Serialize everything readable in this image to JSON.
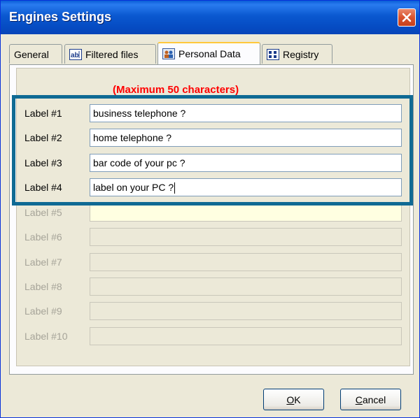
{
  "window": {
    "title": "Engines Settings",
    "close_icon": "close-icon"
  },
  "tabs": [
    {
      "label": "General",
      "icon": null,
      "active": false
    },
    {
      "label": "Filtered files",
      "icon": "ab-text-icon",
      "active": false
    },
    {
      "label": "Personal Data",
      "icon": "personal-data-icon",
      "active": true
    },
    {
      "label": "Registry",
      "icon": "registry-icon",
      "active": false
    }
  ],
  "personal_data": {
    "max_note": "(Maximum 50 characters)",
    "rows": [
      {
        "label": "Label #1",
        "value": "business telephone ?",
        "enabled": true
      },
      {
        "label": "Label #2",
        "value": "home telephone ?",
        "enabled": true
      },
      {
        "label": "Label #3",
        "value": "bar code of your pc ?",
        "enabled": true
      },
      {
        "label": "Label #4",
        "value": "label on your PC ?",
        "enabled": true
      },
      {
        "label": "Label #5",
        "value": "",
        "enabled": false
      },
      {
        "label": "Label #6",
        "value": "",
        "enabled": false
      },
      {
        "label": "Label #7",
        "value": "",
        "enabled": false
      },
      {
        "label": "Label #8",
        "value": "",
        "enabled": false
      },
      {
        "label": "Label #9",
        "value": "",
        "enabled": false
      },
      {
        "label": "Label #10",
        "value": "",
        "enabled": false
      }
    ]
  },
  "buttons": {
    "ok_mnemonic": "O",
    "ok_rest": "K",
    "cancel_mnemonic": "C",
    "cancel_rest": "ancel"
  },
  "colors": {
    "title_bar": "#0a58d0",
    "max_note": "#ff0000",
    "highlight_frame": "#0f6a94",
    "label5_field": "#ffffe1"
  }
}
